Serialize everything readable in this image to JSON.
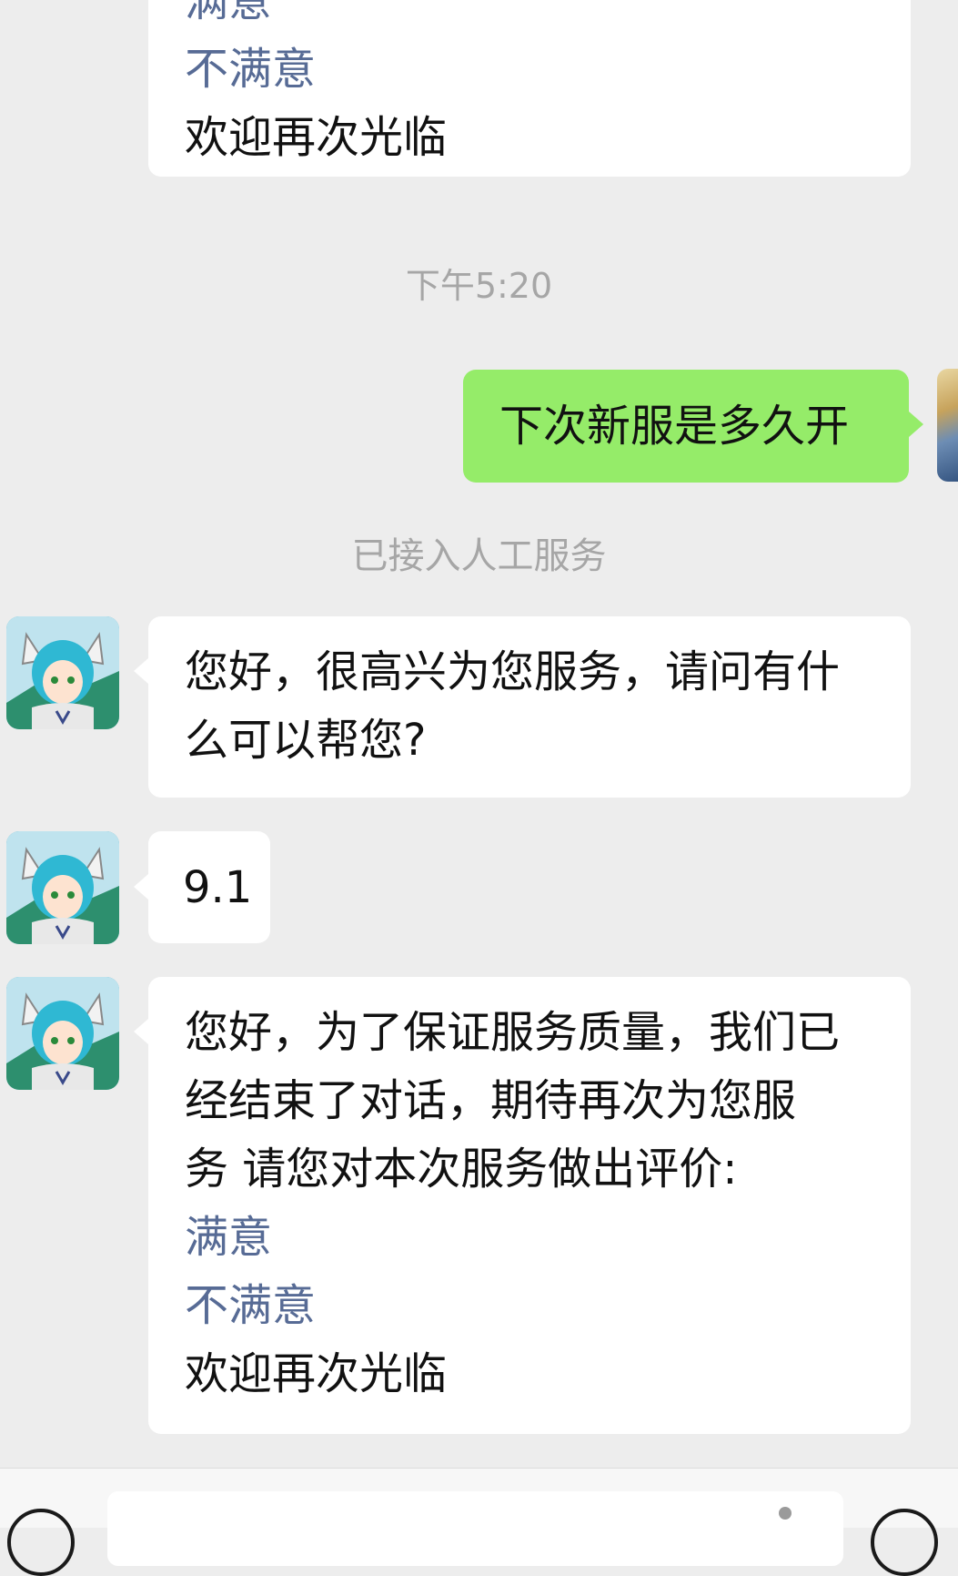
{
  "messages": {
    "prev_rating": {
      "partial_top": "满意",
      "dissatisfied": "不满意",
      "welcome": "欢迎再次光临"
    },
    "timestamp": "下午5:20",
    "user_question": "下次新服是多久开",
    "system_notice": "已接入人工服务",
    "agent_greeting": {
      "line1": "您好，很高兴为您服务，请问有什",
      "line2": "么可以帮您?"
    },
    "agent_reply": "9.1",
    "closing": {
      "line1": "您好，为了保证服务质量，我们已",
      "line2": "经结束了对话，期待再次为您服",
      "line3": "务 请您对本次服务做出评价:",
      "satisfied": "满意",
      "dissatisfied": "不满意",
      "welcome": "欢迎再次光临"
    }
  },
  "input": {
    "placeholder": ""
  },
  "icons": {
    "voice": "voice-icon",
    "emoji": "emoji-icon",
    "agent_avatar": "anime-cat-girl-avatar",
    "user_avatar": "photo-avatar"
  },
  "colors": {
    "background": "#ededed",
    "incoming_bubble": "#ffffff",
    "outgoing_bubble": "#95ec69",
    "link": "#576b95",
    "system_text": "#a6a6a6"
  }
}
